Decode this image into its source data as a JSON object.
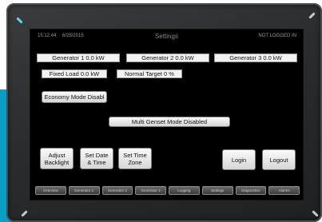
{
  "header": {
    "time": "15:12:44",
    "date": "6/25/2015",
    "title": "Settings",
    "user": "NOT LOGGED IN"
  },
  "status_fields": {
    "gen1": "Generator 1 0.0 kW",
    "gen2": "Generator 2 0.0 kW",
    "gen3": "Generator 3  0.0 kW",
    "fixed_load": "Fixed Load 0.0 kW",
    "normal_target": "Normal Target  0 %"
  },
  "buttons": {
    "economy_mode": "Economy Mode Disabl",
    "multi_genset": "Multi Genset Mode Disabled",
    "adjust_backlight": [
      "Adjust",
      "Backlight"
    ],
    "set_date_time": [
      "Set Date",
      "& Time"
    ],
    "set_time_zone": [
      "Set Time",
      "Zone"
    ],
    "login": "Login",
    "logout": "Logout"
  },
  "nav": {
    "items": [
      "Overview",
      "Generator 1",
      "Generator 2",
      "Generator 3",
      "Logging",
      "Settings",
      "Diagnostics",
      "Alarms"
    ]
  },
  "colors": {
    "screen_bg": "#000000",
    "bezel": "#2a2c2e",
    "accent_stripe": "#0b9ec4"
  }
}
